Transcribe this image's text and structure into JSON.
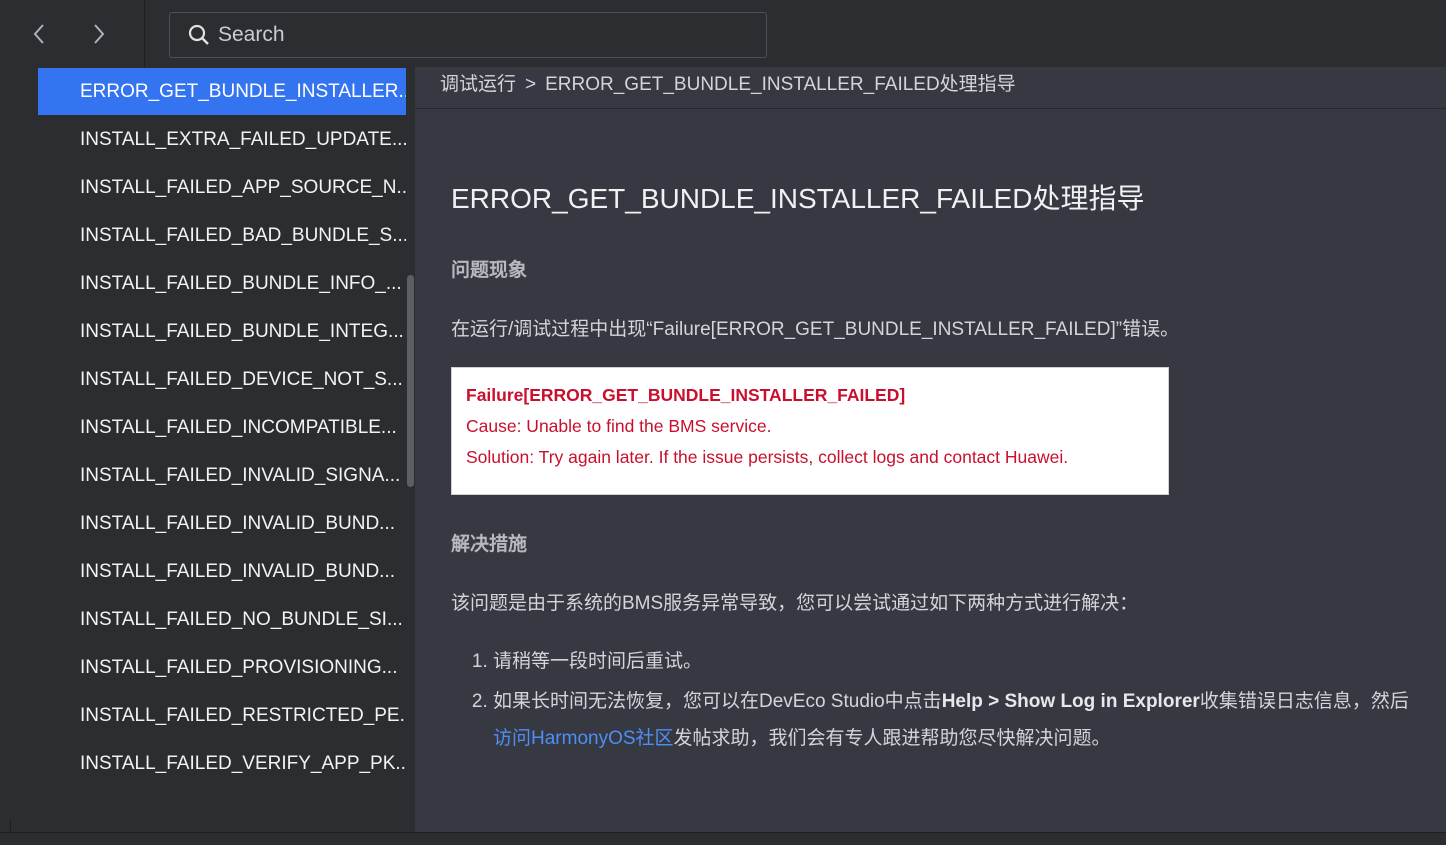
{
  "search": {
    "placeholder": "Search"
  },
  "sidebar": {
    "items": [
      {
        "label": "ERROR_GET_BUNDLE_INSTALLER..."
      },
      {
        "label": "INSTALL_EXTRA_FAILED_UPDATE..."
      },
      {
        "label": "INSTALL_FAILED_APP_SOURCE_N..."
      },
      {
        "label": "INSTALL_FAILED_BAD_BUNDLE_S..."
      },
      {
        "label": "INSTALL_FAILED_BUNDLE_INFO_..."
      },
      {
        "label": "INSTALL_FAILED_BUNDLE_INTEG..."
      },
      {
        "label": "INSTALL_FAILED_DEVICE_NOT_S..."
      },
      {
        "label": "INSTALL_FAILED_INCOMPATIBLE..."
      },
      {
        "label": "INSTALL_FAILED_INVALID_SIGNA..."
      },
      {
        "label": "INSTALL_FAILED_INVALID_BUND..."
      },
      {
        "label": "INSTALL_FAILED_INVALID_BUND..."
      },
      {
        "label": "INSTALL_FAILED_NO_BUNDLE_SI..."
      },
      {
        "label": "INSTALL_FAILED_PROVISIONING..."
      },
      {
        "label": "INSTALL_FAILED_RESTRICTED_PE..."
      },
      {
        "label": "INSTALL_FAILED_VERIFY_APP_PK..."
      }
    ]
  },
  "breadcrumb": {
    "parent": "调试运行",
    "separator": ">",
    "current": "ERROR_GET_BUNDLE_INSTALLER_FAILED处理指导"
  },
  "article": {
    "title": "ERROR_GET_BUNDLE_INSTALLER_FAILED处理指导",
    "section1_heading": "问题现象",
    "section1_text": "在运行/调试过程中出现“Failure[ERROR_GET_BUNDLE_INSTALLER_FAILED]”错误。",
    "error_box": {
      "line1": "Failure[ERROR_GET_BUNDLE_INSTALLER_FAILED]",
      "line2": "Cause: Unable to find the BMS service.",
      "line3": "Solution: Try again later. If the issue persists, collect logs and contact Huawei."
    },
    "section2_heading": "解决措施",
    "section2_text": "该问题是由于系统的BMS服务异常导致，您可以尝试通过如下两种方式进行解决：",
    "steps": {
      "step1": "请稍等一段时间后重试。",
      "step2_pre": "如果长时间无法恢复，您可以在DevEco Studio中点击",
      "step2_bold": "Help > Show Log in Explorer",
      "step2_mid": "收集错误日志信息，然后",
      "step2_link": "访问HarmonyOS社区",
      "step2_post": "发帖求助，我们会有专人跟进帮助您尽快解决问题。"
    }
  },
  "colors": {
    "accent": "#3574f0",
    "link": "#4e8ef7",
    "error_text": "#c8102e"
  }
}
